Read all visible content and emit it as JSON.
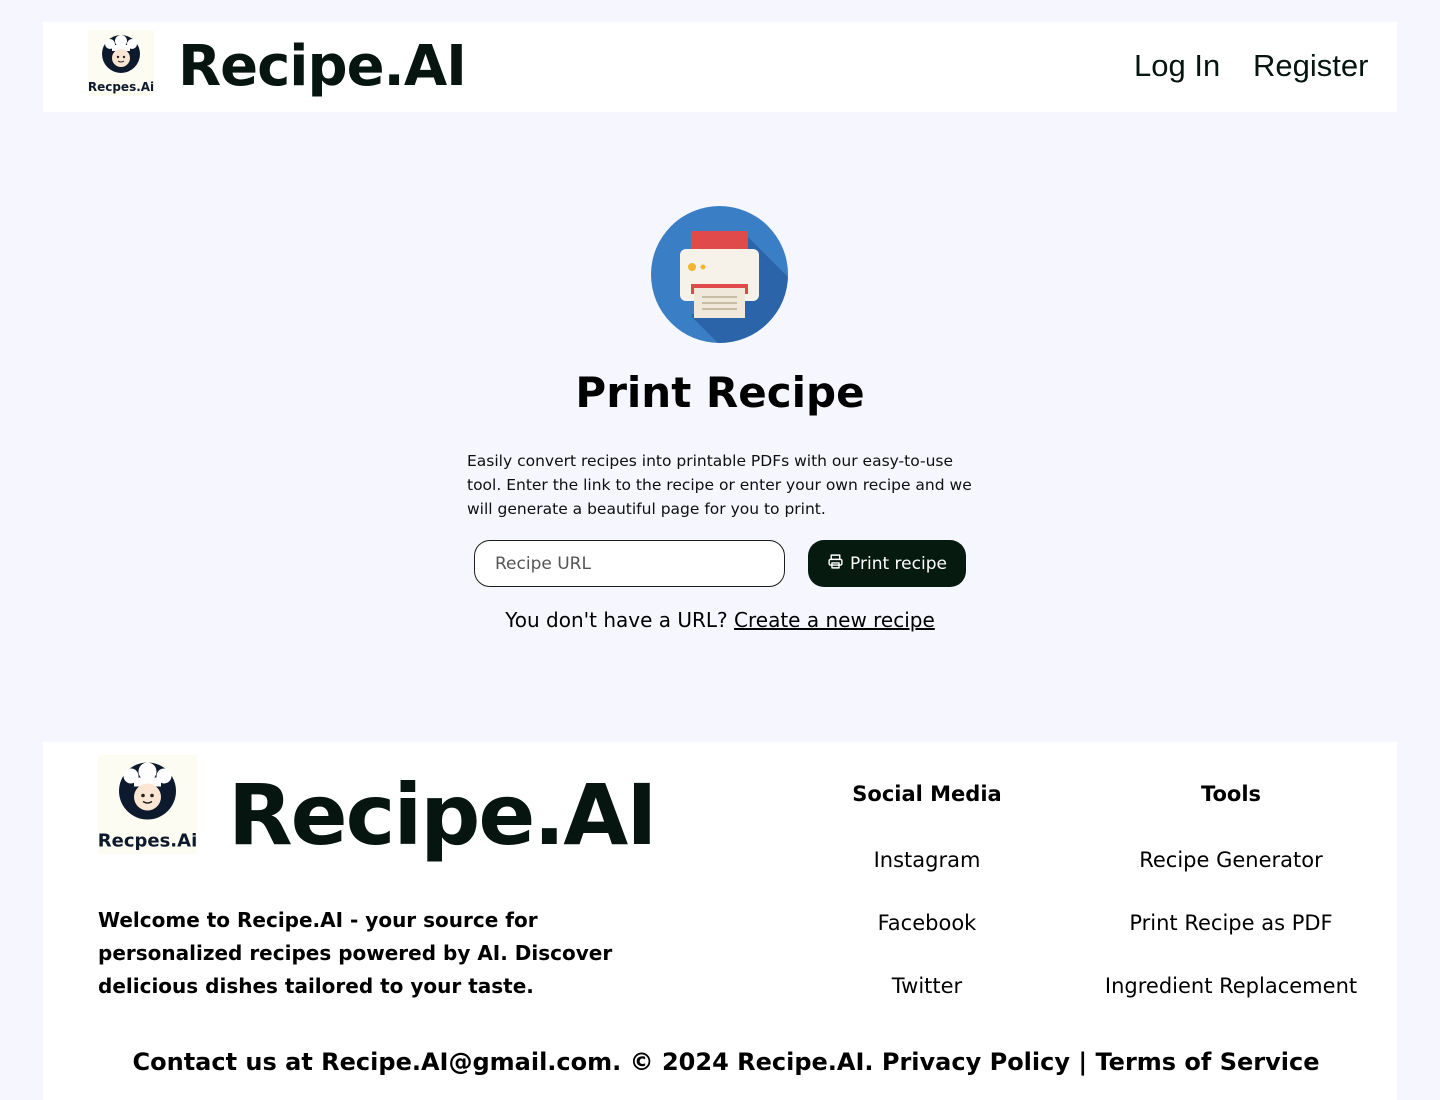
{
  "header": {
    "logo_text": "Recpes.Ai",
    "brand": "Recipe.AI",
    "nav": {
      "login": "Log In",
      "register": "Register"
    }
  },
  "hero": {
    "icon": "printer-icon",
    "title": "Print Recipe",
    "description": "Easily convert recipes into printable PDFs with our easy-to-use tool. Enter the link to the recipe or enter your own recipe and we will generate a beautiful page for you to print.",
    "url_input": {
      "placeholder": "Recipe URL",
      "value": ""
    },
    "print_button": "Print recipe",
    "no_url_text": "You don't have a URL?",
    "create_link": "Create a new recipe"
  },
  "footer": {
    "logo_text": "Recpes.Ai",
    "brand": "Recipe.AI",
    "about": "Welcome to Recipe.AI - your source for personalized recipes powered by AI. Discover delicious dishes tailored to your taste.",
    "social": {
      "heading": "Social Media",
      "links": [
        "Instagram",
        "Facebook",
        "Twitter"
      ]
    },
    "tools": {
      "heading": "Tools",
      "links": [
        "Recipe Generator",
        "Print Recipe as PDF",
        "Ingredient Replacement"
      ]
    },
    "contact": "Contact us at Recipe.AI@gmail.com. © 2024 Recipe.AI. Privacy Policy | Terms of Service"
  },
  "colors": {
    "page_bg": "#f5f6fe",
    "brand_dark": "#061510",
    "button_bg": "#071a10",
    "printer_circle": "#3b82c8"
  }
}
